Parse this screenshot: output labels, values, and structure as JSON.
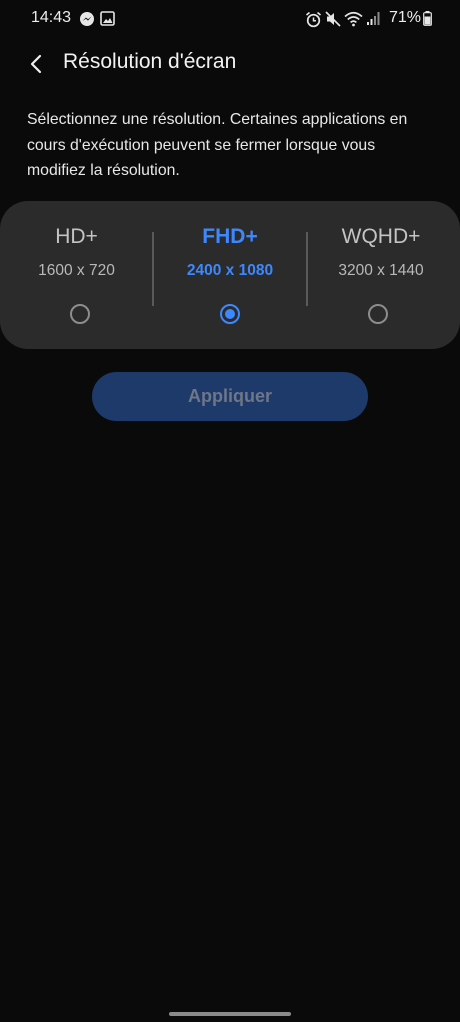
{
  "status_bar": {
    "time": "14:43",
    "battery": "71%",
    "icons": [
      "messenger-icon",
      "gallery-icon",
      "alarm-icon",
      "mute-icon",
      "wifi-icon",
      "signal-icon",
      "battery-icon"
    ]
  },
  "header": {
    "back_icon": "chevron-left-icon",
    "title": "Résolution d'écran"
  },
  "description": "Sélectionnez une résolution. Certaines applications en cours d'exécution peuvent se fermer lorsque vous modifiez la résolution.",
  "resolutions": [
    {
      "name": "HD+",
      "size": "1600 x 720",
      "selected": false
    },
    {
      "name": "FHD+",
      "size": "2400 x 1080",
      "selected": true
    },
    {
      "name": "WQHD+",
      "size": "3200 x 1440",
      "selected": false
    }
  ],
  "apply_button": {
    "label": "Appliquer",
    "enabled": false
  },
  "colors": {
    "accent": "#3d88ff",
    "background": "#0a0a0a",
    "card": "#2b2b2b",
    "button_disabled": "#1e3a6a"
  }
}
